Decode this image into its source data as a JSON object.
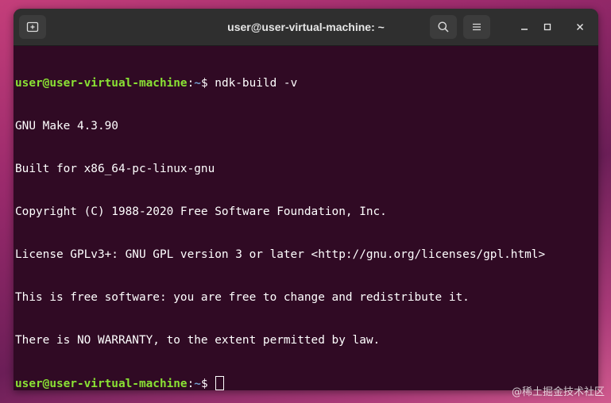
{
  "window": {
    "title": "user@user-virtual-machine: ~",
    "icons": {
      "new_tab": "new-tab-icon",
      "search": "search-icon",
      "menu": "hamburger-menu-icon",
      "minimize": "minimize-icon",
      "maximize": "maximize-icon",
      "close": "close-icon"
    }
  },
  "terminal": {
    "prompt_user": "user@user-virtual-machine",
    "prompt_sep": ":",
    "prompt_path": "~",
    "prompt_symbol": "$ ",
    "command": "ndk-build -v",
    "output": [
      "GNU Make 4.3.90",
      "Built for x86_64-pc-linux-gnu",
      "Copyright (C) 1988-2020 Free Software Foundation, Inc.",
      "License GPLv3+: GNU GPL version 3 or later <http://gnu.org/licenses/gpl.html>",
      "This is free software: you are free to change and redistribute it.",
      "There is NO WARRANTY, to the extent permitted by law."
    ],
    "colors": {
      "background": "#300a24",
      "user": "#8ae234",
      "path": "#729fcf",
      "text": "#ffffff"
    }
  },
  "watermark": "@稀土掘金技术社区"
}
